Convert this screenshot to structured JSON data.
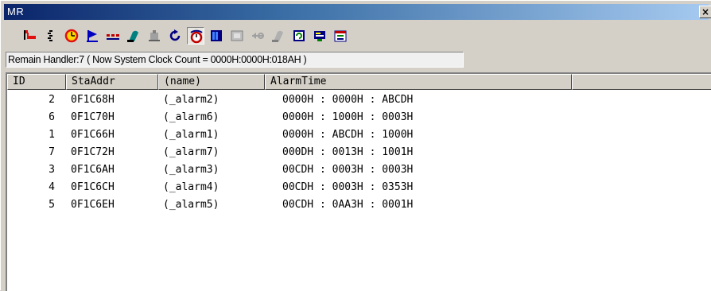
{
  "window": {
    "title": "MR",
    "close_glyph": "×"
  },
  "toolbar": {
    "buttons": [
      {
        "icon": "task-icon",
        "color": "#e01010"
      },
      {
        "icon": "ready-queue-icon",
        "color": "#000000"
      },
      {
        "icon": "timeout-clock-icon",
        "color": "#e01010"
      },
      {
        "icon": "event-flag-icon",
        "color": "#0000c0"
      },
      {
        "icon": "semaphore-icon",
        "color": "#c00000"
      },
      {
        "icon": "mailbox-icon",
        "color": "#008080"
      },
      {
        "icon": "memory-pool-icon",
        "color": "#808080"
      },
      {
        "icon": "cyclic-handler-icon",
        "color": "#000080"
      },
      {
        "icon": "alarm-handler-icon",
        "color": "#c00000",
        "pressed": true
      },
      {
        "icon": "message-buffer-icon",
        "color": "#000080"
      },
      {
        "icon": "port-icon",
        "color": "#808080"
      },
      {
        "icon": "rendezvous-icon",
        "color": "#808080"
      },
      {
        "icon": "variable-memory-icon",
        "color": "#808080"
      },
      {
        "icon": "interrupt-icon",
        "color": "#008000"
      },
      {
        "icon": "system-status-icon",
        "color": "#000080"
      },
      {
        "icon": "calendar-icon",
        "color": "#c00000"
      }
    ]
  },
  "status": {
    "text": "Remain Handler:7 ( Now System Clock Count = 0000H:0000H:018AH )"
  },
  "table": {
    "columns": [
      "ID",
      "StaAddr",
      "(name)",
      "AlarmTime"
    ],
    "rows": [
      {
        "id": "2",
        "staaddr": "0F1C68H",
        "name": "(_alarm2)",
        "alarmtime": "0000H : 0000H : ABCDH"
      },
      {
        "id": "6",
        "staaddr": "0F1C70H",
        "name": "(_alarm6)",
        "alarmtime": "0000H : 1000H : 0003H"
      },
      {
        "id": "1",
        "staaddr": "0F1C66H",
        "name": "(_alarm1)",
        "alarmtime": "0000H : ABCDH : 1000H"
      },
      {
        "id": "7",
        "staaddr": "0F1C72H",
        "name": "(_alarm7)",
        "alarmtime": "000DH : 0013H : 1001H"
      },
      {
        "id": "3",
        "staaddr": "0F1C6AH",
        "name": "(_alarm3)",
        "alarmtime": "00CDH : 0003H : 0003H"
      },
      {
        "id": "4",
        "staaddr": "0F1C6CH",
        "name": "(_alarm4)",
        "alarmtime": "00CDH : 0003H : 0353H"
      },
      {
        "id": "5",
        "staaddr": "0F1C6EH",
        "name": "(_alarm5)",
        "alarmtime": "00CDH : 0AA3H : 0001H"
      }
    ]
  }
}
